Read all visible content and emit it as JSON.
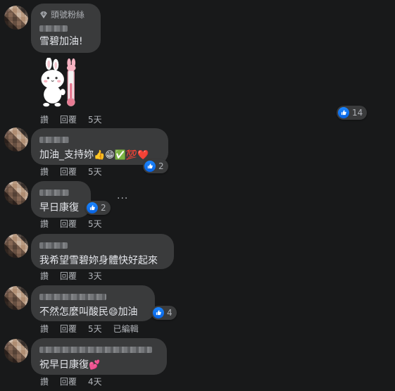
{
  "comments": [
    {
      "badge": "頭號粉絲",
      "text": "雪碧加油!",
      "actions": {
        "like": "讚",
        "reply": "回覆",
        "time": "5天"
      },
      "reactions": "14",
      "has_sticker": true
    },
    {
      "text": "加油_支持妳",
      "emojis": "👍😁✅💯❤️",
      "actions": {
        "like": "讚",
        "reply": "回覆",
        "time": "5天"
      },
      "reactions": "2"
    },
    {
      "text": "早日康復",
      "actions": {
        "like": "讚",
        "reply": "回覆",
        "time": "5天"
      },
      "reactions": "2",
      "more": "···"
    },
    {
      "text": "我希望雪碧妳身體快好起來",
      "actions": {
        "like": "讚",
        "reply": "回覆",
        "time": "3天"
      }
    },
    {
      "text_before": "不然怎麼叫酸民",
      "emoji_mid": "😄",
      "text_after": "加油",
      "actions": {
        "like": "讚",
        "reply": "回覆",
        "time": "5天",
        "edited": "已編輯"
      },
      "reactions": "4"
    },
    {
      "text": "祝早日康復",
      "emojis": "💕",
      "actions": {
        "like": "讚",
        "reply": "回覆",
        "time": "4天"
      }
    }
  ],
  "colors": {
    "background": "#18191a",
    "bubble": "#3a3b3c",
    "text": "#e4e6eb",
    "secondary": "#b0b3b8",
    "like_blue": "#1877f2"
  }
}
